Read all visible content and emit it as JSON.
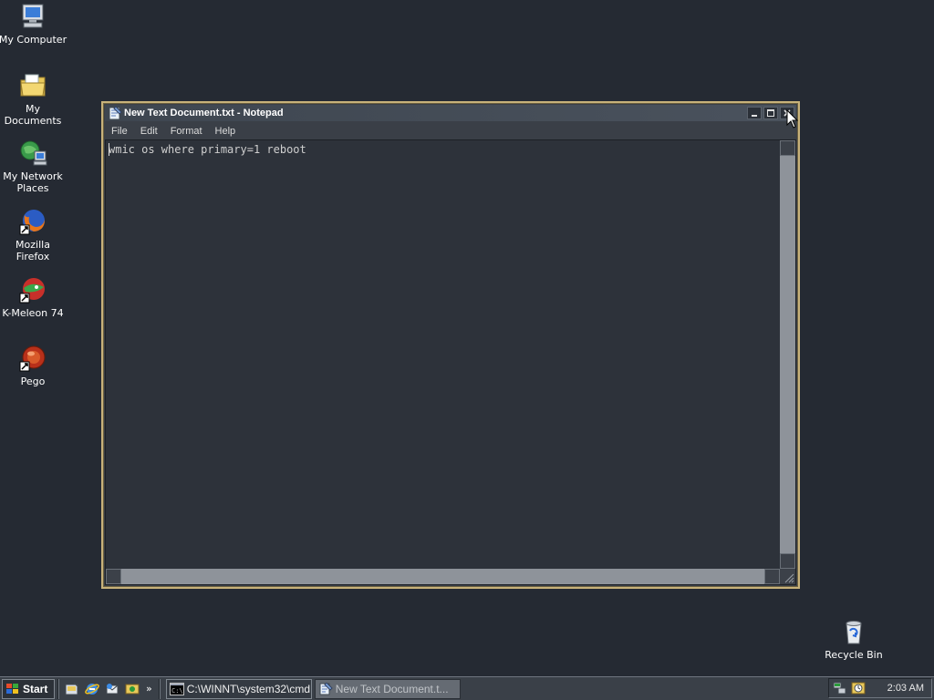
{
  "desktop": {
    "icons": [
      {
        "label": "My Computer",
        "icon": "computer-icon"
      },
      {
        "label": "My Documents",
        "icon": "folder-icon"
      },
      {
        "label": "My Network Places",
        "icon": "network-icon"
      },
      {
        "label": "Mozilla Firefox",
        "icon": "firefox-icon"
      },
      {
        "label": "K-Meleon 74",
        "icon": "kmeleon-icon"
      },
      {
        "label": "Pego",
        "icon": "pego-icon"
      },
      {
        "label": "Recycle Bin",
        "icon": "recycle-bin-icon"
      }
    ]
  },
  "notepad": {
    "title": "New Text Document.txt - Notepad",
    "menus": [
      "File",
      "Edit",
      "Format",
      "Help"
    ],
    "content": "wmic os where primary=1 reboot"
  },
  "taskbar": {
    "start_label": "Start",
    "chevron": "»",
    "tasks": [
      {
        "label": "C:\\WINNT\\system32\\cmd...",
        "icon": "cmd-icon",
        "active": false
      },
      {
        "label": "New Text Document.t...",
        "icon": "notepad-icon",
        "active": true
      }
    ],
    "clock": "2:03 AM"
  },
  "colors": {
    "desktop": "#252a33",
    "window_border": "#c8b27a",
    "editor_bg": "#2d323a",
    "taskbar": "#3a4048"
  }
}
